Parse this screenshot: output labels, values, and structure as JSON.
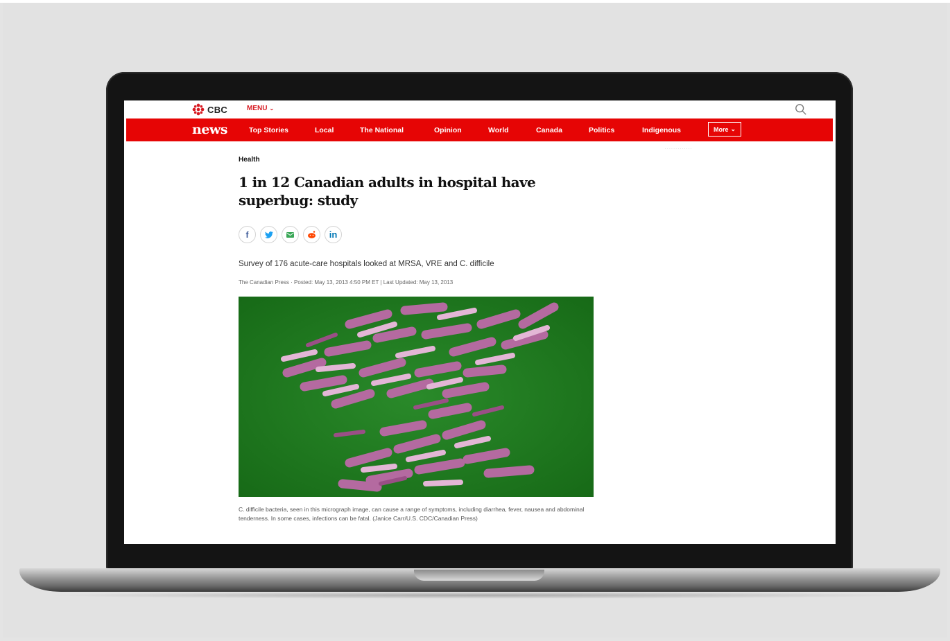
{
  "site": {
    "brand": "CBC",
    "menu_label": "MENU",
    "section_logo": "news"
  },
  "nav": {
    "items": [
      {
        "label": "Top Stories"
      },
      {
        "label": "Local"
      },
      {
        "label": "The National"
      },
      {
        "label": "Opinion"
      },
      {
        "label": "World"
      },
      {
        "label": "Canada"
      },
      {
        "label": "Politics"
      },
      {
        "label": "Indigenous"
      }
    ],
    "more_label": "More"
  },
  "article": {
    "category": "Health",
    "headline": "1 in 12 Canadian adults in hospital have superbug: study",
    "deck": "Survey of 176 acute-care hospitals looked at MRSA, VRE and C. difficile",
    "byline": "The Canadian Press · Posted: May 13, 2013 4:50 PM ET | Last Updated: May 13, 2013",
    "caption": "C. difficile bacteria, seen in this micrograph image, can cause a range of symptoms, including diarrhea, fever, nausea and abdominal tenderness. In some cases, infections can be fatal. (Janice Carr/U.S. CDC/Canadian Press)"
  },
  "share": [
    {
      "icon": "facebook-icon",
      "glyph": "f",
      "color": "#3b5998"
    },
    {
      "icon": "twitter-icon",
      "glyph": "✓",
      "color": "#1da1f2"
    },
    {
      "icon": "email-icon",
      "glyph": "✉",
      "color": "#3aa757"
    },
    {
      "icon": "reddit-icon",
      "glyph": "●",
      "color": "#ff4500"
    },
    {
      "icon": "linkedin-icon",
      "glyph": "in",
      "color": "#0077b5"
    }
  ],
  "colors": {
    "brand_red": "#e60505",
    "menu_red": "#d71921",
    "image_green": "#1f7a1f",
    "bacteria_pink": "#c77fb0"
  }
}
